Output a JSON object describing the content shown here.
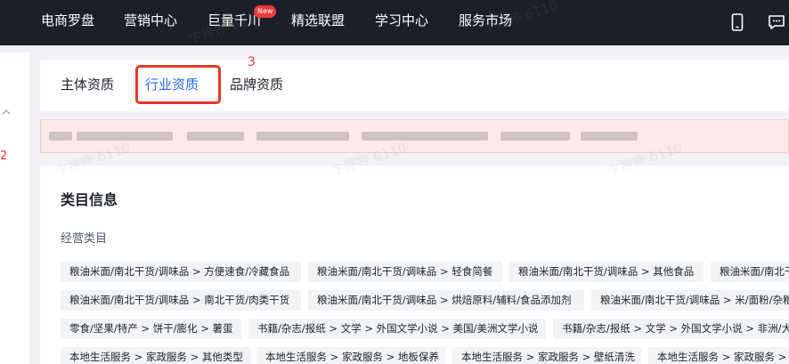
{
  "topbar": {
    "items": [
      {
        "label": "电商罗盘"
      },
      {
        "label": "营销中心"
      },
      {
        "label": "巨量千川"
      },
      {
        "label": "精选联盟"
      },
      {
        "label": "学习中心"
      },
      {
        "label": "服务市场"
      }
    ],
    "new_badge": "New",
    "icons": [
      "phone-icon",
      "message-icon"
    ]
  },
  "sidebar": {
    "annotation": "2"
  },
  "tabs": {
    "items": [
      {
        "label": "主体资质",
        "active": false
      },
      {
        "label": "行业资质",
        "active": true
      },
      {
        "label": "品牌资质",
        "active": false
      }
    ],
    "annotation": "3"
  },
  "category": {
    "title": "类目信息",
    "field_label": "经营类目",
    "tags": [
      [
        "粮油米面/南北干货/调味品 > 方便速食/冷藏食品",
        "粮油米面/南北干货/调味品 > 轻食简餐",
        "粮油米面/南北干货/调味品 > 其他食品",
        "粮油米面/南北干货/调味品"
      ],
      [
        "粮油米面/南北干货/调味品 > 南北干货/肉类干货",
        "粮油米面/南北干货/调味品 > 烘焙原料/辅料/食品添加剂",
        "粮油米面/南北干货/调味品 > 米/面粉/杂粮"
      ],
      [
        "零食/坚果/特产 > 饼干/膨化 > 薯蛋",
        "书籍/杂志/报纸 > 文学 > 外国文学小说 > 美国/美洲文学小说",
        "书籍/杂志/报纸 > 文学 > 外国文学小说 > 非洲/大洋洲"
      ],
      [
        "本地生活服务 > 家政服务 > 其他类型",
        "本地生活服务 > 家政服务 > 地板保养",
        "本地生活服务 > 家政服务 > 壁纸清洗",
        "本地生活服务 > 家政服务 > 外墙清洗"
      ]
    ]
  },
  "colors": {
    "topbar_bg": "#1b1f2a",
    "accent": "#2c6bff",
    "annotation_red": "#e8382b",
    "alert_bg": "#fce9ea"
  }
}
